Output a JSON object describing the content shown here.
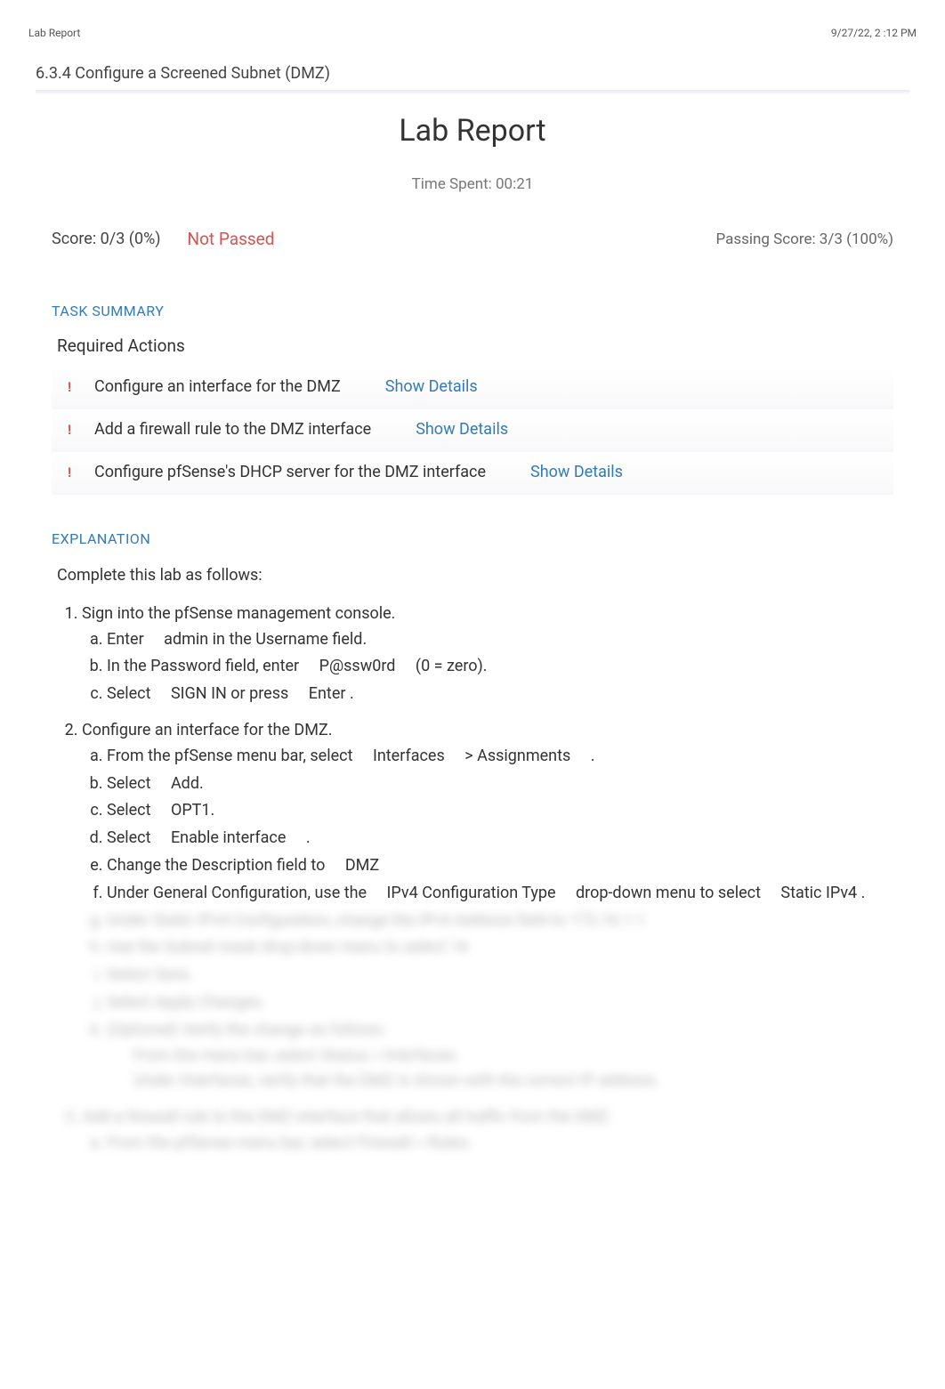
{
  "header": {
    "left": "Lab Report",
    "right": "9/27/22, 2   :12 PM"
  },
  "section_title": "6.3.4 Configure a Screened Subnet (DMZ)",
  "main_title": "Lab Report",
  "time_spent": "Time Spent: 00:21",
  "score": {
    "value": "Score: 0/3 (0%)",
    "status": "Not Passed",
    "passing": "Passing Score: 3/3 (100%)"
  },
  "task_summary_label": "TASK SUMMARY",
  "required_actions_label": "Required Actions",
  "tasks": [
    {
      "text": "Configure an interface for the DMZ",
      "link": "Show Details"
    },
    {
      "text": "Add a firewall rule to the DMZ interface",
      "link": "Show Details"
    },
    {
      "text": "Configure pfSense's DHCP server for the DMZ interface",
      "link": "Show Details"
    }
  ],
  "explanation_label": "EXPLANATION",
  "intro": "Complete this lab as follows:",
  "steps": {
    "s1": {
      "title": "Sign into the pfSense management console.",
      "a_pre": "Enter ",
      "a_mid": "admin",
      "a_post": " in the Username field.",
      "b_pre": "In the Password field, enter ",
      "b_mid": "P@ssw0rd",
      "b_post": " (0 = zero).",
      "c_pre": "Select ",
      "c_mid1": "SIGN IN",
      "c_mid2": " or press ",
      "c_mid3": "Enter",
      "c_post": " ."
    },
    "s2": {
      "title": "Configure an interface for the DMZ.",
      "a_pre": "From the pfSense menu bar, select ",
      "a_mid1": "Interfaces",
      "a_mid2": " > ",
      "a_mid3": "Assignments",
      "a_post": " .",
      "b_pre": "Select ",
      "b_mid": "Add",
      "b_post": ".",
      "c_pre": "Select ",
      "c_mid": "OPT1",
      "c_post": ".",
      "d_pre": "Select ",
      "d_mid": "Enable interface",
      "d_post": " .",
      "e_pre": "Change the Description field to ",
      "e_mid": "DMZ",
      "f_pre": "Under General Configuration, use the ",
      "f_mid1": "IPv4 Configuration Type",
      "f_mid2": " drop-down menu to select ",
      "f_mid3": "Static IPv4",
      "f_post": " ."
    },
    "blurred": {
      "g": "Under Static IPv4 Configuration, change the IPv4 Address field to        172.16.1.1",
      "h": "Use the Subnet mask drop-down menu to select        16",
      "i": "Select Save.",
      "j": "Select Apply Changes.",
      "k": "(Optional) Verify the change as follows:",
      "k1": "From the menu bar, select       Status > Interfaces.",
      "k2": "Under Interfaces, verify that the DMZ is shown with the correct IP address.",
      "s3": "Add a firewall rule to the DMZ interface that allows all traffic from the DMZ.",
      "s3a": "From the pfSense menu bar, select       Firewall > Rules."
    }
  }
}
